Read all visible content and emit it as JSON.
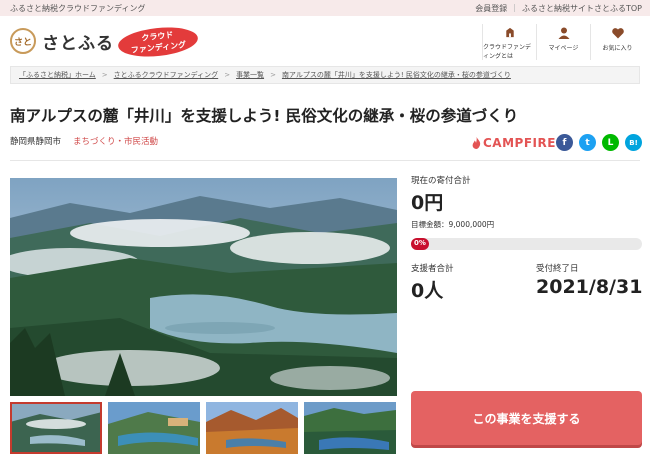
{
  "topbar": {
    "tagline": "ふるさと納税クラウドファンディング",
    "links": [
      "会員登録",
      "ふるさと納税サイトさとふるTOP"
    ]
  },
  "header": {
    "logo_text": "さとふる",
    "logo_mark": "さと",
    "badge_line1": "クラウド",
    "badge_line2": "ファンディング",
    "nav": [
      {
        "label": "クラウドファンディングとは",
        "icon": "crowdfunding-icon"
      },
      {
        "label": "マイページ",
        "icon": "user-icon"
      },
      {
        "label": "お気に入り",
        "icon": "heart-icon"
      }
    ]
  },
  "breadcrumb": [
    "「ふるさと納税」ホーム",
    "さとふるクラウドファンディング",
    "事業一覧",
    "南アルプスの麓「井川」を支援しよう! 民俗文化の継承・桜の参道づくり"
  ],
  "project": {
    "title": "南アルプスの麓「井川」を支援しよう! 民俗文化の継承・桜の参道づくり",
    "location": "静岡県静岡市",
    "category": "まちづくり・市民活動",
    "platform": "CAMPFIRE",
    "social": [
      "f",
      "t",
      "L",
      "B!"
    ]
  },
  "funding": {
    "current_label": "現在の寄付合計",
    "current_value": "0円",
    "goal_text": "目標金額：9,000,000円",
    "progress_percent": 0,
    "progress_label": "0%",
    "supporters_label": "支援者合計",
    "supporters_value": "0人",
    "deadline_label": "受付終了日",
    "deadline_value": "2021/8/31",
    "cta_label": "この事業を支援する"
  },
  "colors": {
    "accent": "#e46262",
    "brand_red": "#e33b3b",
    "progress_fill": "#c8102e",
    "category": "#d04a4a"
  }
}
